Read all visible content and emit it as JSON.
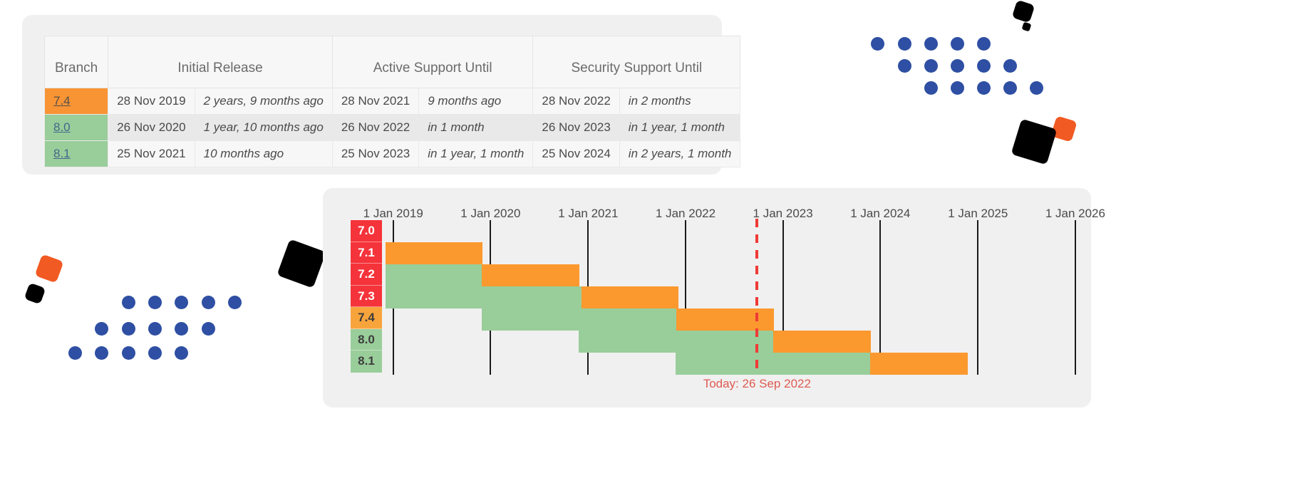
{
  "colors": {
    "orange": "#fb992f",
    "green": "#99cd9a",
    "red": "#f5333a",
    "today_red": "#e05a52",
    "link_blue": "#46688c",
    "card_bg": "#f0f0f0",
    "dot_blue": "#2e4fa3",
    "square_orange": "#f15a22"
  },
  "table": {
    "headers": [
      "Branch",
      "Initial Release",
      "Active Support Until",
      "Security Support Until"
    ],
    "rows": [
      {
        "branch": "7.4",
        "branch_status": "orange",
        "initial_release_date": "28 Nov 2019",
        "initial_release_rel": "2 years, 9 months ago",
        "active_support_date": "28 Nov 2021",
        "active_support_rel": "9 months ago",
        "security_support_date": "28 Nov 2022",
        "security_support_rel": "in 2 months"
      },
      {
        "branch": "8.0",
        "branch_status": "green",
        "initial_release_date": "26 Nov 2020",
        "initial_release_rel": "1 year, 10 months ago",
        "active_support_date": "26 Nov 2022",
        "active_support_rel": "in 1 month",
        "security_support_date": "26 Nov 2023",
        "security_support_rel": "in 1 year, 1 month"
      },
      {
        "branch": "8.1",
        "branch_status": "green",
        "initial_release_date": "25 Nov 2021",
        "initial_release_rel": "10 months ago",
        "active_support_date": "25 Nov 2023",
        "active_support_rel": "in 1 year, 1 month",
        "security_support_date": "25 Nov 2024",
        "security_support_rel": "in 2 years, 1 month"
      }
    ]
  },
  "chart_data": {
    "type": "bar",
    "subtype": "gantt-timeline",
    "title": "",
    "xlabel": "",
    "ylabel": "",
    "today_label": "Today: 26 Sep 2022",
    "today_date": "2022-09-26",
    "axis_ticks": [
      "1 Jan 2019",
      "1 Jan 2020",
      "1 Jan 2021",
      "1 Jan 2022",
      "1 Jan 2023",
      "1 Jan 2024",
      "1 Jan 2025",
      "1 Jan 2026"
    ],
    "axis_tick_dates": [
      "2019-01-01",
      "2020-01-01",
      "2021-01-01",
      "2022-01-01",
      "2023-01-01",
      "2024-01-01",
      "2025-01-01",
      "2026-01-01"
    ],
    "xlim": [
      "2018-11-20",
      "2026-03-01"
    ],
    "grid": true,
    "legend": "none",
    "categories": [
      "7.0",
      "7.1",
      "7.2",
      "7.3",
      "7.4",
      "8.0",
      "8.1"
    ],
    "series": [
      {
        "name": "Active Support",
        "color": "#99cd9a",
        "spans": [
          {
            "branch": "7.0",
            "start": "2018-12-03",
            "end": "2018-12-03"
          },
          {
            "branch": "7.1",
            "start": "2018-12-03",
            "end": "2018-12-03"
          },
          {
            "branch": "7.2",
            "start": "2018-12-03",
            "end": "2019-11-30"
          },
          {
            "branch": "7.3",
            "start": "2018-12-03",
            "end": "2020-12-06"
          },
          {
            "branch": "7.4",
            "start": "2019-11-28",
            "end": "2021-11-28"
          },
          {
            "branch": "8.0",
            "start": "2020-11-26",
            "end": "2022-11-26"
          },
          {
            "branch": "8.1",
            "start": "2021-11-25",
            "end": "2023-11-25"
          }
        ]
      },
      {
        "name": "Security Support",
        "color": "#fb992f",
        "spans": [
          {
            "branch": "7.0",
            "start": "2018-12-03",
            "end": "2018-12-03"
          },
          {
            "branch": "7.1",
            "start": "2018-12-03",
            "end": "2019-12-01"
          },
          {
            "branch": "7.2",
            "start": "2019-11-30",
            "end": "2020-11-30"
          },
          {
            "branch": "7.3",
            "start": "2020-12-06",
            "end": "2021-12-06"
          },
          {
            "branch": "7.4",
            "start": "2021-11-28",
            "end": "2022-11-28"
          },
          {
            "branch": "8.0",
            "start": "2022-11-26",
            "end": "2023-11-26"
          },
          {
            "branch": "8.1",
            "start": "2023-11-25",
            "end": "2024-11-25"
          }
        ]
      }
    ],
    "branch_status_colors": {
      "7.0": "#f5333a",
      "7.1": "#f5333a",
      "7.2": "#f5333a",
      "7.3": "#f5333a",
      "7.4": "#f8a43c",
      "8.0": "#99cd9a",
      "8.1": "#99cd9a"
    }
  }
}
